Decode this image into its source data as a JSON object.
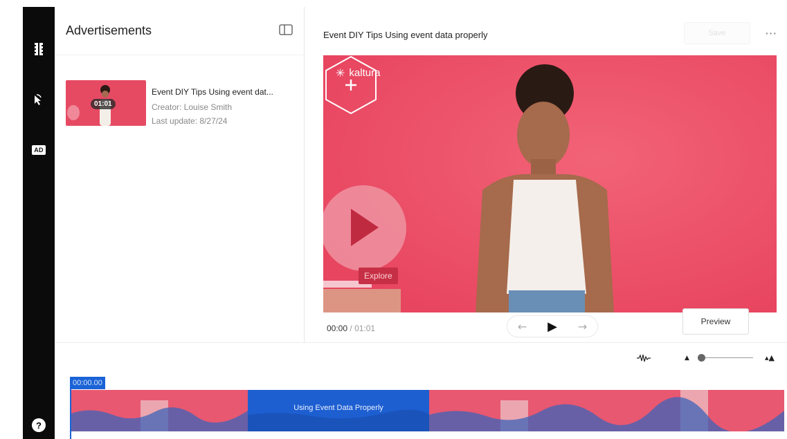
{
  "sidebar": {
    "items": [
      {
        "icon": "film-strip-icon"
      },
      {
        "icon": "cursor-click-icon"
      },
      {
        "icon": "ad-icon",
        "label": "AD"
      },
      {
        "icon": "help-icon",
        "label": "?"
      }
    ]
  },
  "ads_panel": {
    "title": "Advertisements",
    "items": [
      {
        "title": "Event DIY Tips Using event dat...",
        "duration": "01:01",
        "creator": "Creator: Louise Smith",
        "updated": "Last update: 8/27/24"
      }
    ]
  },
  "editor": {
    "title": "Event DIY Tips Using event data properly",
    "save_label": "Save",
    "more_label": "···",
    "video": {
      "brand": "kaltura",
      "overlay_button": "Explore"
    },
    "current_time": "00:00",
    "separator": "/",
    "total_time": "01:01",
    "preview_label": "Preview"
  },
  "timeline": {
    "timestamp": "00:00.00",
    "clip_label": "Using Event Data Properly"
  },
  "colors": {
    "video_bg": "#ec4e68",
    "accent_blue": "#1a63d6",
    "rail": "#0b0b0b"
  }
}
